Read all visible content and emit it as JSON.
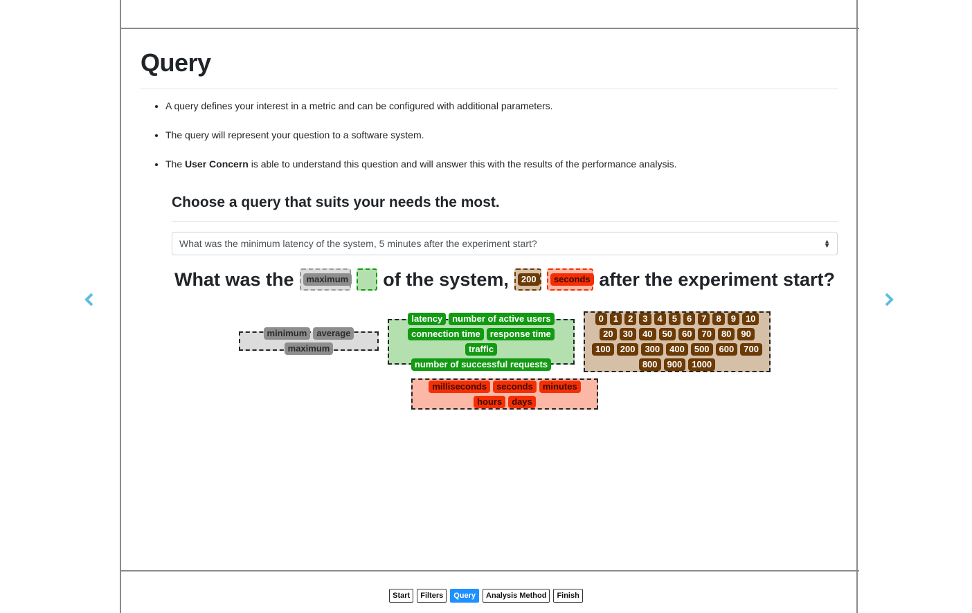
{
  "page": {
    "title": "Query",
    "bullets": [
      {
        "pre": "A query defines your interest in a metric and can be configured with additional parameters.",
        "bold": "",
        "post": ""
      },
      {
        "pre": "The query will represent your question to a software system.",
        "bold": "",
        "post": ""
      },
      {
        "pre": "The ",
        "bold": "User Concern",
        "post": " is able to understand this question and will answer this with the results of the performance analysis."
      }
    ],
    "choose_heading": "Choose a query that suits your needs the most.",
    "select_value": "What was the minimum latency of the system, 5 minutes after the experiment start?"
  },
  "sentence": {
    "part1": "What was the",
    "aggregate": "maximum",
    "metric": "",
    "part2": "of the system,",
    "number": "200",
    "unit": "seconds",
    "part3": "after the experiment start?"
  },
  "pools": {
    "aggregates": [
      "minimum",
      "average",
      "maximum"
    ],
    "metrics": [
      "latency",
      "number of active users",
      "connection time",
      "response time",
      "traffic",
      "number of successful requests"
    ],
    "numbers": [
      "0",
      "1",
      "2",
      "3",
      "4",
      "5",
      "6",
      "7",
      "8",
      "9",
      "10",
      "20",
      "30",
      "40",
      "50",
      "60",
      "70",
      "80",
      "90",
      "100",
      "200",
      "300",
      "400",
      "500",
      "600",
      "700",
      "800",
      "900",
      "1000"
    ],
    "units": [
      "milliseconds",
      "seconds",
      "minutes",
      "hours",
      "days"
    ]
  },
  "steps": [
    {
      "label": "Start",
      "active": false
    },
    {
      "label": "Filters",
      "active": false
    },
    {
      "label": "Query",
      "active": true
    },
    {
      "label": "Analysis Method",
      "active": false
    },
    {
      "label": "Finish",
      "active": false
    }
  ],
  "colors": {
    "arrow": "#5bc0de",
    "step_active": "#1e90ff",
    "aggregate": "#8e8e8e",
    "metric": "#129a12",
    "number": "#6b3a05",
    "unit": "#f52f05"
  },
  "icons": {
    "prev": "chevron-left-icon",
    "next": "chevron-right-icon",
    "select_caret": "sort-caret-icon"
  }
}
